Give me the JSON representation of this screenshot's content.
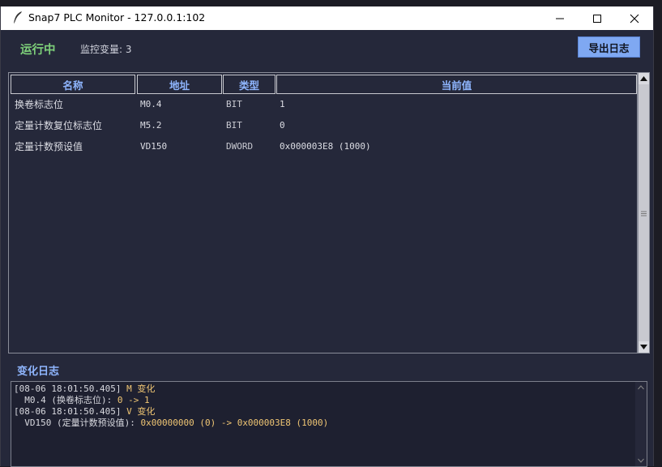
{
  "window": {
    "title": "Snap7 PLC Monitor - 127.0.0.1:102"
  },
  "top_bar": {
    "status": "运行中",
    "var_count_label": "监控变量: 3",
    "export_button": "导出日志"
  },
  "table": {
    "headers": [
      "名称",
      "地址",
      "类型",
      "当前值"
    ],
    "rows": [
      {
        "name": "换卷标志位",
        "address": "M0.4",
        "type": "BIT",
        "value": "1"
      },
      {
        "name": "定量计数复位标志位",
        "address": "M5.2",
        "type": "BIT",
        "value": "0"
      },
      {
        "name": "定量计数预设值",
        "address": "VD150",
        "type": "DWORD",
        "value": "0x000003E8 (1000)"
      }
    ]
  },
  "log": {
    "title": "变化日志",
    "lines": [
      {
        "prefix": "[08-06 18:01:50.405] ",
        "kw": "M 变化",
        "rest": ""
      },
      {
        "prefix": "  M0.4 (换卷标志位): ",
        "kw": "0 -> 1",
        "rest": ""
      },
      {
        "prefix": "[08-06 18:01:50.405] ",
        "kw": "V 变化",
        "rest": ""
      },
      {
        "prefix": "  VD150 (定量计数预设值): ",
        "kw": "0x00000000 (0) -> 0x000003E8 (1000)",
        "rest": ""
      }
    ]
  },
  "colors": {
    "background": "#25283a",
    "running_green": "#7ed17a",
    "header_blue": "#8fb6ff",
    "export_button_bg": "#7fa8f2",
    "log_highlight": "#f0c674"
  }
}
